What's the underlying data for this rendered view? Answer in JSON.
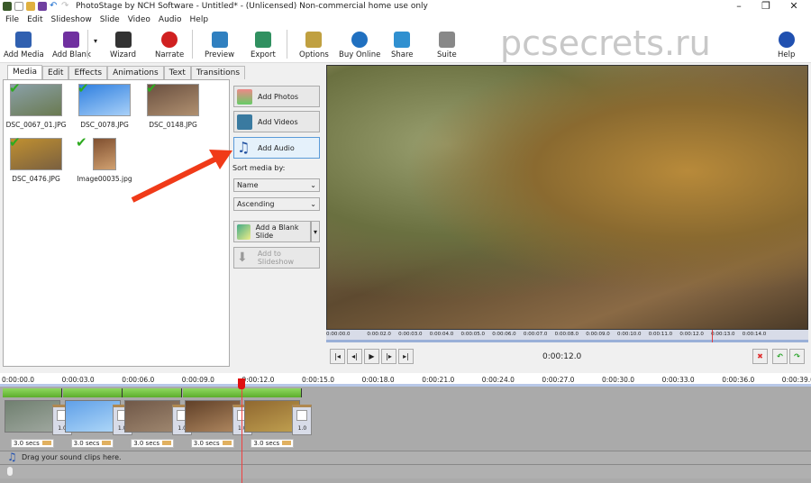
{
  "window": {
    "title": "PhotoStage by NCH Software - Untitled* - (Unlicensed) Non-commercial home use only"
  },
  "menu": [
    "File",
    "Edit",
    "Slideshow",
    "Slide",
    "Video",
    "Audio",
    "Help"
  ],
  "toolbar": [
    {
      "label": "Add Media",
      "icon": "add-media-icon",
      "color": "#3060b0"
    },
    {
      "label": "Add Blank",
      "icon": "add-blank-icon",
      "color": "#7030a0"
    },
    {
      "label": "Wizard",
      "icon": "wizard-icon",
      "color": "#333"
    },
    {
      "label": "Narrate",
      "icon": "record-icon",
      "color": "#d02020"
    },
    {
      "label": "Preview",
      "icon": "preview-icon",
      "color": "#3080c0"
    },
    {
      "label": "Export",
      "icon": "export-icon",
      "color": "#309060"
    },
    {
      "label": "Options",
      "icon": "options-icon",
      "color": "#c0a040"
    },
    {
      "label": "Buy Online",
      "icon": "globe-icon",
      "color": "#2070c0"
    },
    {
      "label": "Share",
      "icon": "share-icon",
      "color": "#3090d0"
    },
    {
      "label": "Suite",
      "icon": "suite-icon",
      "color": "#888"
    },
    {
      "label": "Help",
      "icon": "help-icon",
      "color": "#2050b0"
    }
  ],
  "watermark": "pcsecrets.ru",
  "tabs": [
    "Media",
    "Edit",
    "Effects",
    "Animations",
    "Text",
    "Transitions"
  ],
  "media": [
    {
      "name": "DSC_0067_01.JPG",
      "colors": [
        "#8aa0a8",
        "#6a7a50"
      ]
    },
    {
      "name": "DSC_0078.JPG",
      "colors": [
        "#3080e0",
        "#a8d0f8"
      ]
    },
    {
      "name": "DSC_0148.JPG",
      "colors": [
        "#6a5040",
        "#b09070"
      ]
    },
    {
      "name": "DSC_0476.JPG",
      "colors": [
        "#c09030",
        "#7a6040"
      ]
    },
    {
      "name": "Image00035.jpg",
      "colors": [
        "#805030",
        "#d0a070"
      ]
    }
  ],
  "side": {
    "add_photos": "Add Photos",
    "add_videos": "Add Videos",
    "add_audio": "Add Audio",
    "sort_label": "Sort media by:",
    "sort_by": "Name",
    "order": "Ascending",
    "add_blank": "Add a Blank Slide",
    "add_to_slideshow": "Add to Slideshow"
  },
  "preview_ruler": [
    "0:00:00.0",
    "0:00:02.0",
    "0:00:03.0",
    "0:00:04.0",
    "0:00:05.0",
    "0:00:06.0",
    "0:00:07.0",
    "0:00:08.0",
    "0:00:09.0",
    "0:00:10.0",
    "0:00:11.0",
    "0:00:12.0",
    "0:00:13.0",
    "0:00:14.0"
  ],
  "current_time": "0:00:12.0",
  "timeline_ruler": [
    "0:00:00.0",
    "0:00:03.0",
    "0:00:06.0",
    "0:00:09.0",
    "0:00:12.0",
    "0:00:15.0",
    "0:00:18.0",
    "0:00:21.0",
    "0:00:24.0",
    "0:00:27.0",
    "0:00:30.0",
    "0:00:33.0",
    "0:00:36.0",
    "0:00:39.0"
  ],
  "clips": [
    {
      "duration": "3.0 secs",
      "transition": "1.0",
      "colors": [
        "#708070",
        "#a0a8a0"
      ]
    },
    {
      "duration": "3.0 secs",
      "transition": "1.0",
      "colors": [
        "#60a0e8",
        "#b0d8f8"
      ]
    },
    {
      "duration": "3.0 secs",
      "transition": "1.0",
      "colors": [
        "#705848",
        "#a08870"
      ]
    },
    {
      "duration": "3.0 secs",
      "transition": "1.0",
      "colors": [
        "#604028",
        "#b08860"
      ]
    },
    {
      "duration": "3.0 secs",
      "transition": "1.0",
      "colors": [
        "#906830",
        "#c0a050"
      ]
    }
  ],
  "sound_track": "Drag your sound clips here."
}
